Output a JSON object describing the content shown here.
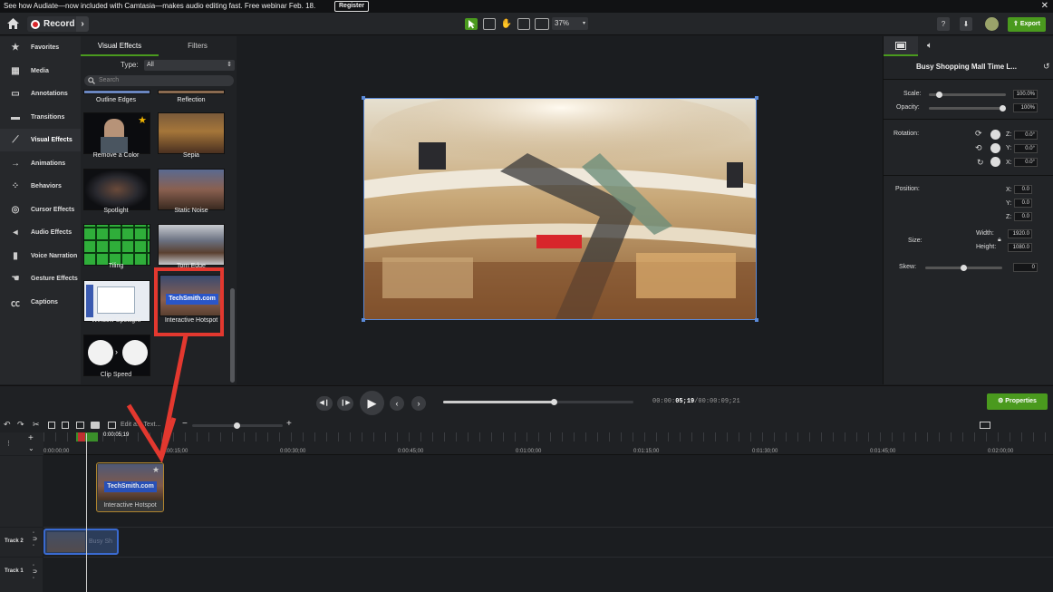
{
  "banner": {
    "text": "See how Audiate—now included with Camtasia—makes audio editing fast. Free webinar Feb. 18.",
    "register": "Register",
    "close": "✕"
  },
  "toolbar": {
    "record": "Record",
    "zoom": "37%",
    "help": "?",
    "export": "Export"
  },
  "nav": [
    {
      "label": "Favorites",
      "icon": "star-icon"
    },
    {
      "label": "Media",
      "icon": "media-icon"
    },
    {
      "label": "Annotations",
      "icon": "annotation-icon"
    },
    {
      "label": "Transitions",
      "icon": "transition-icon"
    },
    {
      "label": "Visual Effects",
      "icon": "wand-icon"
    },
    {
      "label": "Animations",
      "icon": "animation-icon"
    },
    {
      "label": "Behaviors",
      "icon": "behavior-icon"
    },
    {
      "label": "Cursor Effects",
      "icon": "cursor-icon"
    },
    {
      "label": "Audio Effects",
      "icon": "speaker-icon"
    },
    {
      "label": "Voice Narration",
      "icon": "mic-icon"
    },
    {
      "label": "Gesture Effects",
      "icon": "hand-icon"
    },
    {
      "label": "Captions",
      "icon": "cc-icon"
    }
  ],
  "effects": {
    "tabs": [
      "Visual Effects",
      "Filters"
    ],
    "type_label": "Type:",
    "type_value": "All",
    "search_placeholder": "Search",
    "items": [
      "Outline Edges",
      "Reflection",
      "Remove a Color",
      "Sepia",
      "Spotlight",
      "Static Noise",
      "Tiling",
      "Torn Edge",
      "Window Spotlight",
      "Interactive Hotspot",
      "Clip Speed"
    ],
    "hotspot_thumb_text": "TechSmith.com"
  },
  "properties": {
    "title": "Busy Shopping Mall Time L...",
    "scale_label": "Scale:",
    "scale": "100.0%",
    "opacity_label": "Opacity:",
    "opacity": "100%",
    "rotation_label": "Rotation:",
    "rot_z": "0.0°",
    "rot_y": "0.0°",
    "rot_x": "0.0°",
    "position_label": "Position:",
    "pos_x": "0.0",
    "pos_y": "0.0",
    "pos_z": "0.0",
    "size_label": "Size:",
    "width_label": "Width:",
    "width": "1920.0",
    "height_label": "Height:",
    "height": "1080.0",
    "skew_label": "Skew:",
    "skew": "0",
    "z": "Z:",
    "y": "Y:",
    "x": "X:",
    "button": "Properties",
    "scale_fraction": 0.1,
    "opacity_fraction": 1.0,
    "skew_fraction": 0.5
  },
  "playback": {
    "time_prefix": "00:00:",
    "time_current": "05;19",
    "time_total": "/00:00:09;21",
    "progress_fraction": 0.58
  },
  "timeline": {
    "edit_label": "Edit a... Text...",
    "playhead_time": "0:00:05;19",
    "ticks": [
      "0:00:00;00",
      "0:00:15;00",
      "0:00:30;00",
      "0:00:45;00",
      "0:01:00;00",
      "0:01:15;00",
      "0:01:30;00",
      "0:01:45;00",
      "0:02:00;00"
    ],
    "dragged_clip": "Interactive Hotspot",
    "clip_thumb_text": "TechSmith.com",
    "track2_clip": "Busy Sh",
    "tracks": [
      "Track 2",
      "Track 1"
    ]
  }
}
